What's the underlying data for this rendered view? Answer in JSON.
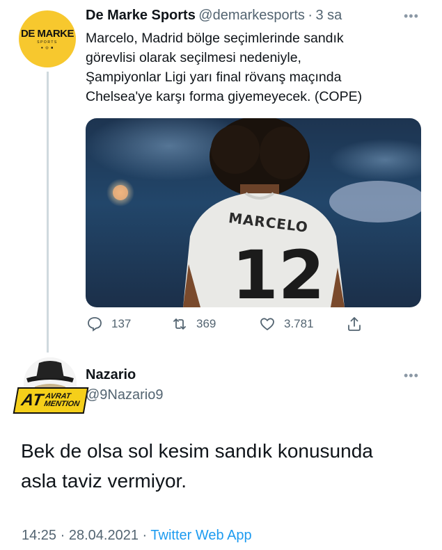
{
  "tweet": {
    "avatar_brand": "DE MARKE",
    "avatar_sub": "SPORTS",
    "display_name": "De Marke Sports",
    "handle": "@demarkesports",
    "separator": "·",
    "time": "3 sa",
    "more": "•••",
    "text_lines": [
      "Marcelo, Madrid bölge seçimlerinde sandık",
      "görevlisi olarak seçilmesi nedeniyle,",
      "Şampiyonlar Ligi yarı final rövanş maçında",
      "Chelsea'ye karşı forma giyemeyecek. (COPE)"
    ],
    "photo": {
      "jersey_name": "MARCELO",
      "jersey_number": "12"
    },
    "actions": {
      "replies": "137",
      "retweets": "369",
      "likes": "3.781"
    }
  },
  "reply": {
    "display_name": "Nazario",
    "handle": "@9Nazario9",
    "more": "•••",
    "badge_big": "AT",
    "badge_top": "AVRAT",
    "badge_bottom": "MENTION",
    "text_lines": [
      "Bek de olsa sol kesim sandık konusunda",
      "asla taviz vermiyor."
    ],
    "time": "14:25",
    "date": "28.04.2021",
    "dot": "·",
    "source": "Twitter Web App"
  },
  "colors": {
    "text": "#0f1419",
    "secondary": "#536471",
    "link": "#1d9bf0",
    "thread": "#cfd9de",
    "brand_yellow": "#f7c82e"
  }
}
